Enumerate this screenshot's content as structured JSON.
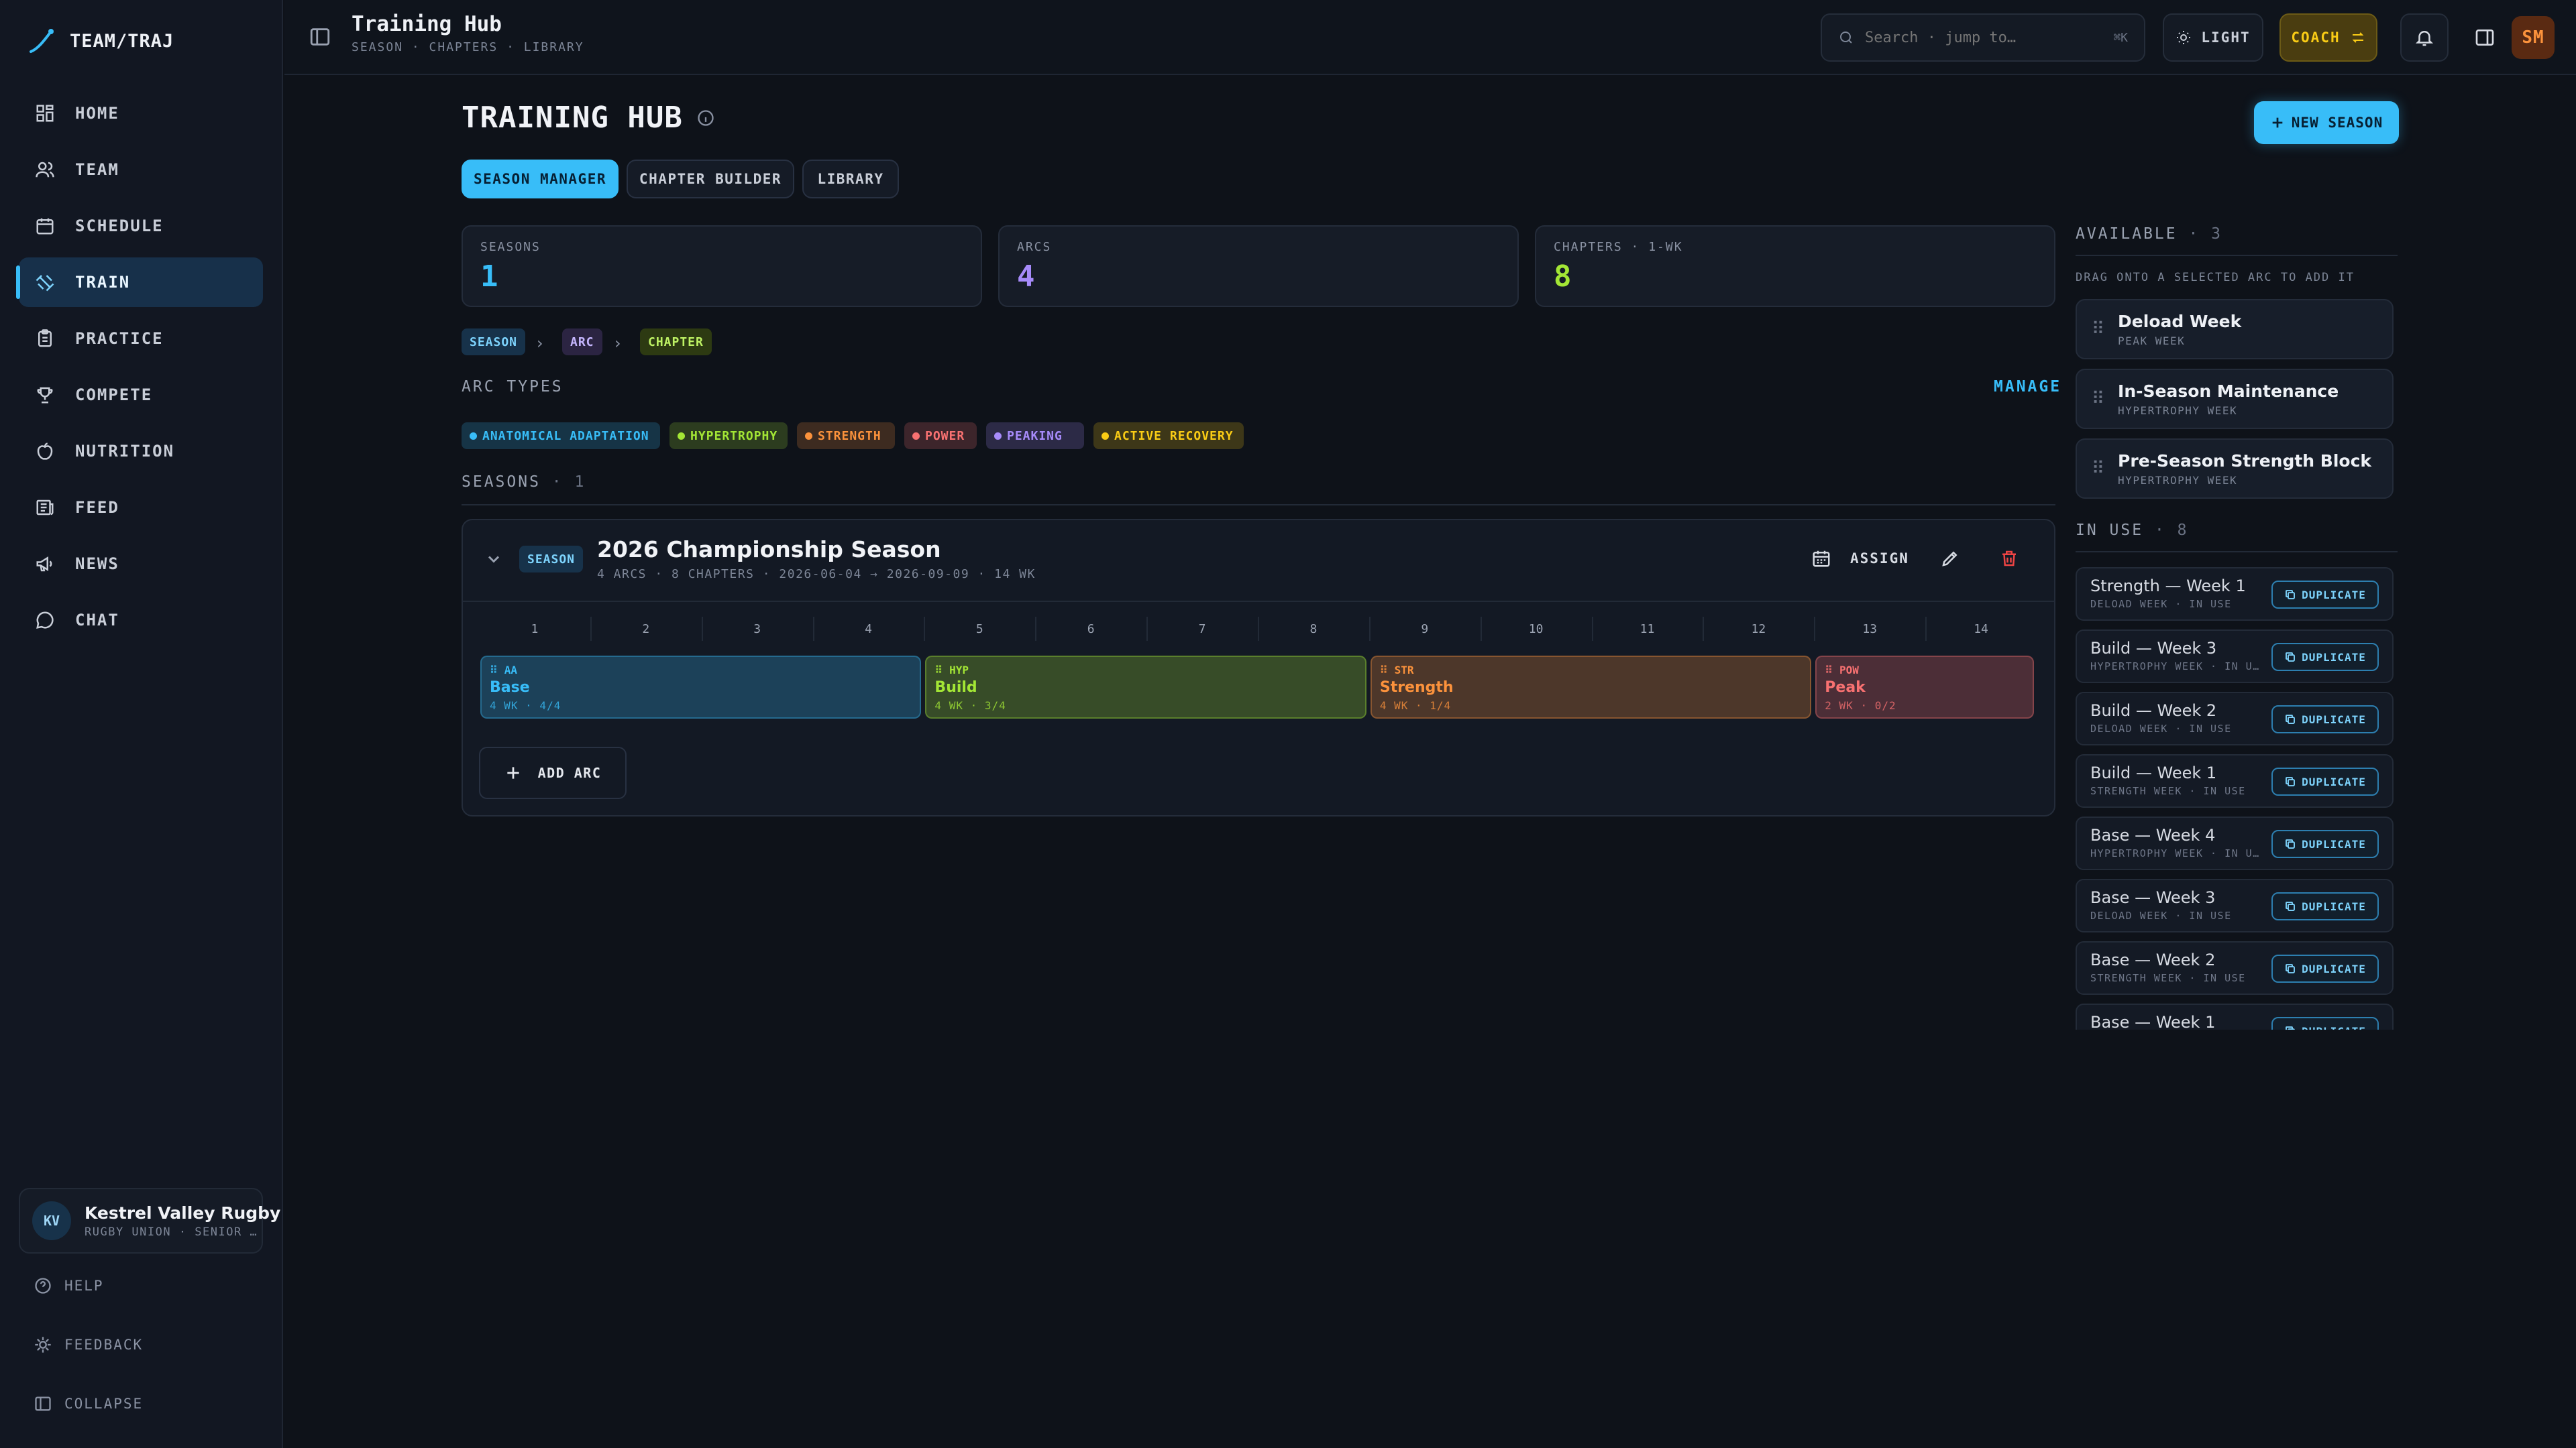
{
  "brand": {
    "name": "TEAM/TRAJ"
  },
  "sidebar": {
    "items": [
      {
        "label": "HOME",
        "icon": "home-icon"
      },
      {
        "label": "TEAM",
        "icon": "users-icon"
      },
      {
        "label": "SCHEDULE",
        "icon": "calendar-icon"
      },
      {
        "label": "TRAIN",
        "icon": "dumbbell-icon",
        "active": true
      },
      {
        "label": "PRACTICE",
        "icon": "clipboard-icon"
      },
      {
        "label": "COMPETE",
        "icon": "trophy-icon"
      },
      {
        "label": "NUTRITION",
        "icon": "apple-icon"
      },
      {
        "label": "FEED",
        "icon": "newspaper-icon"
      },
      {
        "label": "NEWS",
        "icon": "megaphone-icon"
      },
      {
        "label": "CHAT",
        "icon": "chat-icon"
      }
    ],
    "org": {
      "initials": "KV",
      "name": "Kestrel Valley Rugby",
      "sub": "RUGBY UNION · SENIOR …"
    },
    "footer": {
      "help": "HELP",
      "feedback": "FEEDBACK",
      "collapse": "COLLAPSE"
    }
  },
  "topbar": {
    "title": "Training Hub",
    "breadcrumb": "SEASON · CHAPTERS · LIBRARY",
    "search_placeholder": "Search · jump to…",
    "search_kbd": "⌘K",
    "theme_label": "LIGHT",
    "role_label": "COACH",
    "avatar": "SM"
  },
  "main": {
    "title": "TRAINING HUB",
    "new_season": "NEW SEASON",
    "tabs": [
      "SEASON MANAGER",
      "CHAPTER BUILDER",
      "LIBRARY"
    ],
    "stats": [
      {
        "label": "SEASONS",
        "value": "1",
        "color": "#38bdf8"
      },
      {
        "label": "ARCS",
        "value": "4",
        "color": "#a78bfa"
      },
      {
        "label": "CHAPTERS · 1-WK",
        "value": "8",
        "color": "#a3e635"
      }
    ],
    "hierarchy": [
      "SEASON",
      "ARC",
      "CHAPTER"
    ],
    "arc_types_heading": "ARC TYPES",
    "manage_label": "MANAGE",
    "arc_types": [
      {
        "label": "ANATOMICAL ADAPTATION",
        "color": "#38bdf8"
      },
      {
        "label": "HYPERTROPHY",
        "color": "#a3e635"
      },
      {
        "label": "STRENGTH",
        "color": "#fb923c"
      },
      {
        "label": "POWER",
        "color": "#f87171"
      },
      {
        "label": "PEAKING",
        "color": "#a78bfa"
      },
      {
        "label": "ACTIVE RECOVERY",
        "color": "#facc15"
      }
    ],
    "seasons_heading": "SEASONS",
    "seasons_count": "1",
    "season": {
      "badge": "SEASON",
      "name": "2026 Championship Season",
      "meta": "4 ARCS · 8 CHAPTERS · 2026-06-04 → 2026-09-09 · 14 WK",
      "assign_label": "ASSIGN",
      "weeks": [
        "1",
        "2",
        "3",
        "4",
        "5",
        "6",
        "7",
        "8",
        "9",
        "10",
        "11",
        "12",
        "13",
        "14"
      ],
      "arcs": [
        {
          "code": "AA",
          "name": "Base",
          "meta": "4 WK · 4/4",
          "start": 1,
          "length": 4,
          "color": "#38bdf8"
        },
        {
          "code": "HYP",
          "name": "Build",
          "meta": "4 WK · 3/4",
          "start": 5,
          "length": 4,
          "color": "#a3e635"
        },
        {
          "code": "STR",
          "name": "Strength",
          "meta": "4 WK · 1/4",
          "start": 9,
          "length": 4,
          "color": "#fb923c"
        },
        {
          "code": "POW",
          "name": "Peak",
          "meta": "2 WK · 0/2",
          "start": 13,
          "length": 2,
          "color": "#f87171"
        }
      ],
      "add_arc": "ADD ARC"
    }
  },
  "library": {
    "available_heading": "AVAILABLE",
    "available_count": "3",
    "hint": "DRAG ONTO A SELECTED ARC TO ADD IT",
    "available": [
      {
        "name": "Deload Week",
        "sub": "PEAK WEEK"
      },
      {
        "name": "In-Season Maintenance",
        "sub": "HYPERTROPHY WEEK"
      },
      {
        "name": "Pre-Season Strength Block",
        "sub": "HYPERTROPHY WEEK"
      }
    ],
    "in_use_heading": "IN USE",
    "in_use_count": "8",
    "duplicate_label": "DUPLICATE",
    "in_use": [
      {
        "name": "Strength — Week 1",
        "sub": "DELOAD WEEK · IN USE"
      },
      {
        "name": "Build — Week 3",
        "sub": "HYPERTROPHY WEEK · IN U…"
      },
      {
        "name": "Build — Week 2",
        "sub": "DELOAD WEEK · IN USE"
      },
      {
        "name": "Build — Week 1",
        "sub": "STRENGTH WEEK · IN USE"
      },
      {
        "name": "Base — Week 4",
        "sub": "HYPERTROPHY WEEK · IN U…"
      },
      {
        "name": "Base — Week 3",
        "sub": "DELOAD WEEK · IN USE"
      },
      {
        "name": "Base — Week 2",
        "sub": "STRENGTH WEEK · IN USE"
      },
      {
        "name": "Base — Week 1",
        "sub": ""
      }
    ]
  }
}
